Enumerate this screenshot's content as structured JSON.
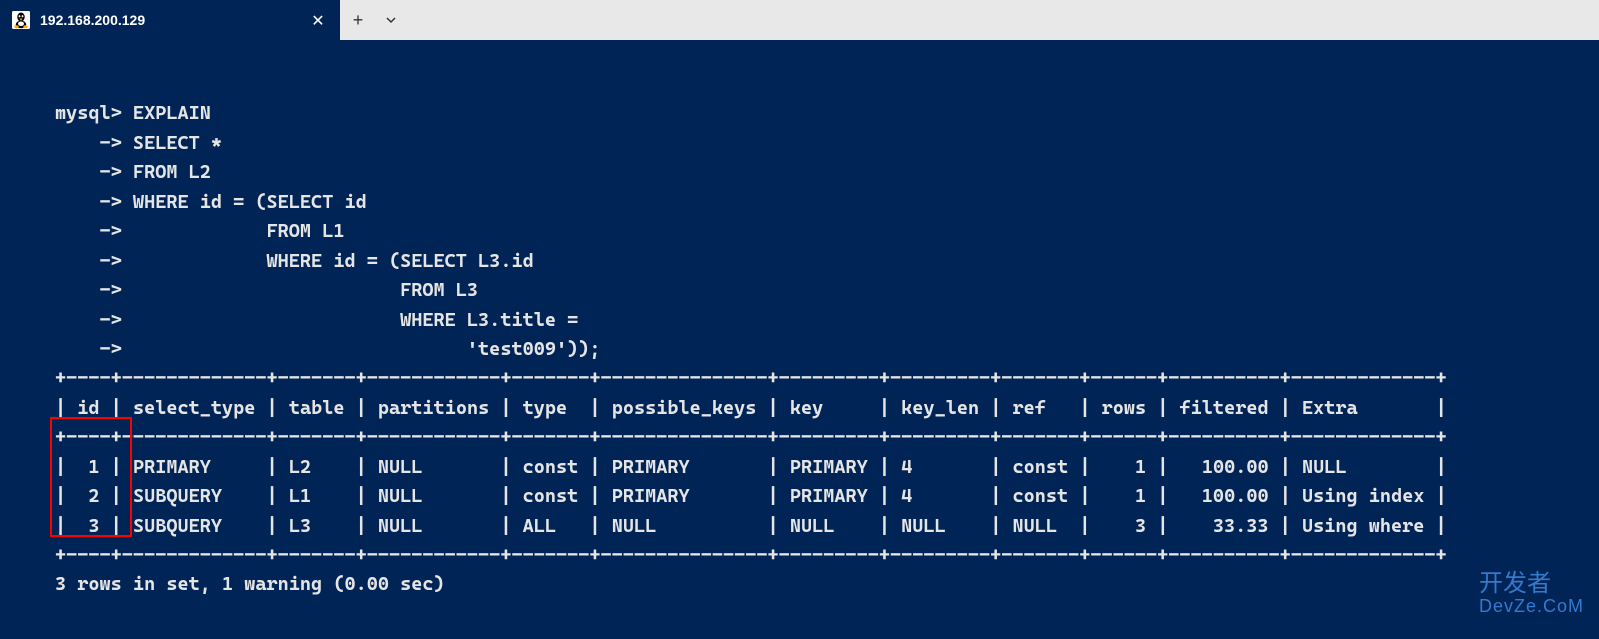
{
  "tab": {
    "title": "192.168.200.129"
  },
  "terminal": {
    "query_lines": [
      "mysql> EXPLAIN",
      "    -> SELECT *",
      "    -> FROM L2",
      "    -> WHERE id = (SELECT id",
      "    ->             FROM L1",
      "    ->             WHERE id = (SELECT L3.id",
      "    ->                         FROM L3",
      "    ->                         WHERE L3.title =",
      "    ->                               'test009'));"
    ],
    "table": {
      "headers": [
        "id",
        "select_type",
        "table",
        "partitions",
        "type",
        "possible_keys",
        "key",
        "key_len",
        "ref",
        "rows",
        "filtered",
        "Extra"
      ],
      "rows": [
        {
          "id": "1",
          "select_type": "PRIMARY",
          "table": "L2",
          "partitions": "NULL",
          "type": "const",
          "possible_keys": "PRIMARY",
          "key": "PRIMARY",
          "key_len": "4",
          "ref": "const",
          "rows": "1",
          "filtered": "100.00",
          "Extra": "NULL"
        },
        {
          "id": "2",
          "select_type": "SUBQUERY",
          "table": "L1",
          "partitions": "NULL",
          "type": "const",
          "possible_keys": "PRIMARY",
          "key": "PRIMARY",
          "key_len": "4",
          "ref": "const",
          "rows": "1",
          "filtered": "100.00",
          "Extra": "Using index"
        },
        {
          "id": "3",
          "select_type": "SUBQUERY",
          "table": "L3",
          "partitions": "NULL",
          "type": "ALL",
          "possible_keys": "NULL",
          "key": "NULL",
          "key_len": "NULL",
          "ref": "NULL",
          "rows": "3",
          "filtered": "33.33",
          "Extra": "Using where"
        }
      ]
    },
    "result_summary": "3 rows in set, 1 warning (0.00 sec)"
  },
  "watermark": {
    "line1": "开发者",
    "line2": "DevZe.CoM"
  }
}
